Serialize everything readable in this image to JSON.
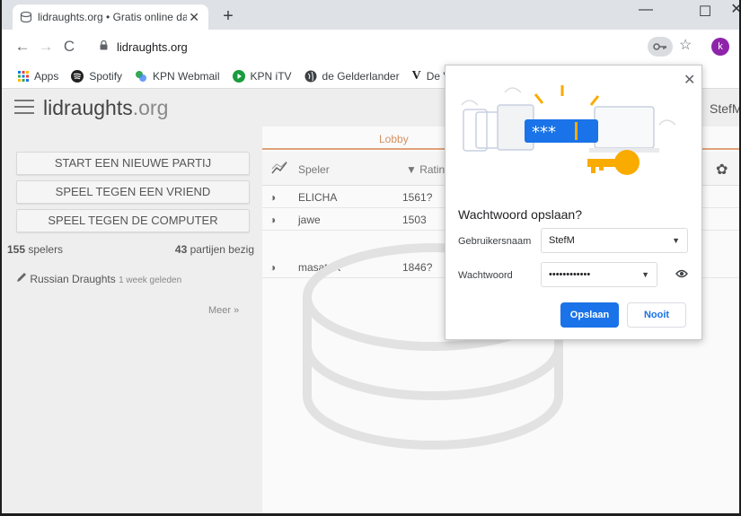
{
  "browser": {
    "tab_title": "lidraughts.org • Gratis online dam",
    "tab_close": "✕",
    "new_tab": "+",
    "url": "lidraughts.org",
    "profile_initial": "k",
    "window": {
      "minimize": "—",
      "maximize": "☐",
      "close": "✕"
    }
  },
  "bookmarks": [
    {
      "label": "Apps",
      "icon": "apps-grid-icon"
    },
    {
      "label": "Spotify",
      "icon": "spotify-icon"
    },
    {
      "label": "KPN Webmail",
      "icon": "kpn-webmail-icon"
    },
    {
      "label": "KPN iTV",
      "icon": "kpn-itv-icon"
    },
    {
      "label": "de Gelderlander",
      "icon": "globe-icon"
    },
    {
      "label": "De Volks",
      "icon": "volkskrant-icon"
    }
  ],
  "site": {
    "logo_main": "lidraughts",
    "logo_tld": ".org",
    "username": "StefM",
    "buttons": [
      "START EEN NIEUWE PARTIJ",
      "SPEEL TEGEN EEN VRIEND",
      "SPEEL TEGEN DE COMPUTER"
    ],
    "players_count": "155",
    "players_label": "spelers",
    "games_count": "43",
    "games_label": "partijen bezig",
    "news_title": "Russian Draughts",
    "news_date": "1 week geleden",
    "more": "Meer »"
  },
  "lobby": {
    "tab": "Lobby",
    "col_player": "Speler",
    "col_rating": "Ratin",
    "rows": [
      {
        "name": "ELICHA",
        "rating": "1561?"
      },
      {
        "name": "jawe",
        "rating": "1503"
      },
      {
        "name": "masatoK",
        "rating": "1846?"
      }
    ]
  },
  "password_dialog": {
    "title": "Wachtwoord opslaan?",
    "username_label": "Gebruikersnaam",
    "username_value": "StefM",
    "password_label": "Wachtwoord",
    "password_value": "••••••••••••",
    "save": "Opslaan",
    "never": "Nooit",
    "illustration_text": "***"
  },
  "colors": {
    "accent_blue": "#1a73e8",
    "lobby_orange": "#d59160",
    "key_yellow": "#f9ab00"
  }
}
